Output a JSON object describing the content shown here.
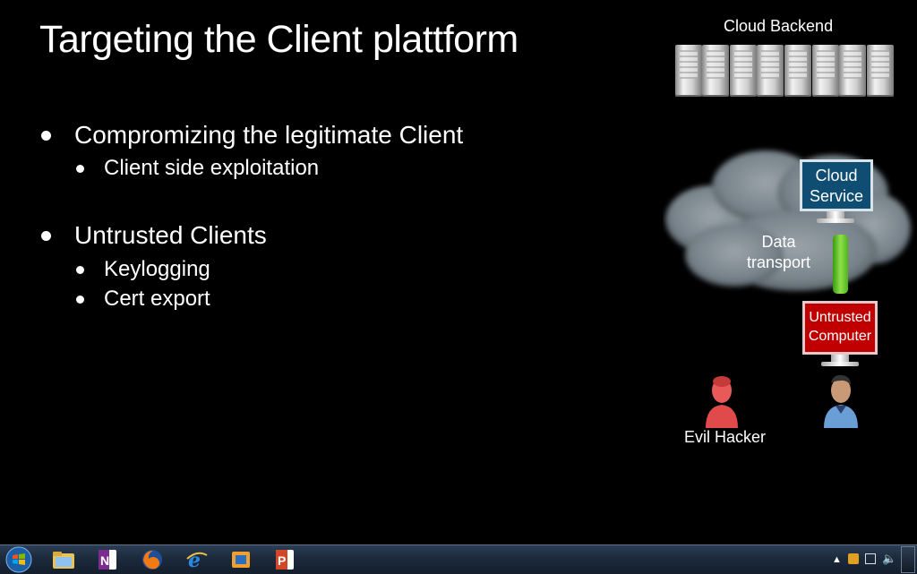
{
  "slide": {
    "title": "Targeting the Client plattform",
    "bullets": [
      {
        "text": "Compromizing the legitimate Client",
        "subs": [
          "Client side exploitation"
        ]
      },
      {
        "text": "Untrusted Clients",
        "subs": [
          "Keylogging",
          "Cert export"
        ]
      }
    ]
  },
  "diagram": {
    "cloud_backend": "Cloud Backend",
    "cloud_service": [
      "Cloud",
      "Service"
    ],
    "data_transport": [
      "Data",
      "transport"
    ],
    "untrusted_computer": [
      "Untrusted",
      "Computer"
    ],
    "evil_hacker": "Evil Hacker"
  },
  "taskbar": {
    "items": [
      "start-orb-icon",
      "windows-explorer-icon",
      "onenote-icon",
      "firefox-icon",
      "internet-explorer-icon",
      "virtualbox-icon",
      "powerpoint-icon"
    ],
    "tray_icons": [
      "show-hidden-icons-arrow",
      "security-shield-icon",
      "network-icon",
      "volume-icon"
    ]
  },
  "colors": {
    "cloud_service": "#0f4d73",
    "untrusted_computer": "#c00000",
    "data_pipe": "#6ccb2e",
    "hacker": "#e85a5a",
    "user_shirt": "#6a9fd6"
  }
}
